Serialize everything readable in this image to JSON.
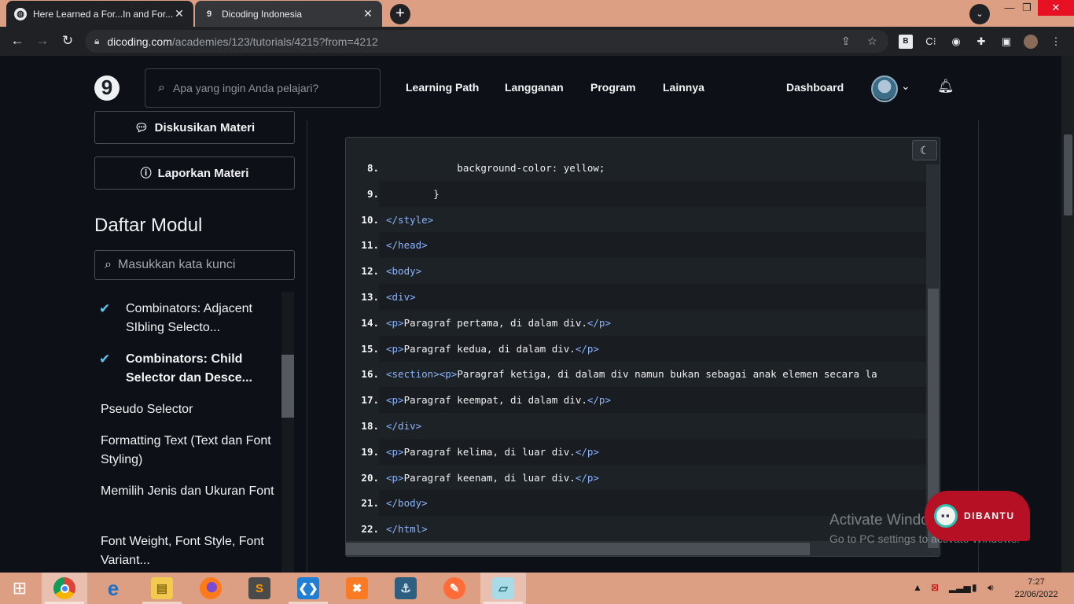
{
  "browser": {
    "tabs": [
      {
        "title": "Here Learned a For...In and For...c",
        "active": true,
        "favicon": "globe-icon"
      },
      {
        "title": "Dicoding Indonesia",
        "active": false,
        "favicon": "dicoding-icon"
      }
    ],
    "new_tab": "+",
    "url_host": "dicoding.com",
    "url_path": "/academies/123/tutorials/4215?from=4212"
  },
  "header": {
    "search_placeholder": "Apa yang ingin Anda pelajari?",
    "nav": [
      "Learning Path",
      "Langganan",
      "Program",
      "Lainnya"
    ],
    "dashboard": "Dashboard"
  },
  "sidebar": {
    "discuss_button": "Diskusikan Materi",
    "report_button": "Laporkan Materi",
    "module_title": "Daftar Modul",
    "module_search_placeholder": "Masukkan kata kunci",
    "modules": [
      {
        "label": "Combinators: Adjacent SIbling Selecto...",
        "done": true,
        "active": false
      },
      {
        "label": "Combinators: Child Selector dan Desce...",
        "done": true,
        "active": true
      },
      {
        "label": "Pseudo Selector",
        "done": false,
        "active": false
      },
      {
        "label": "Formatting Text (Text dan Font Styling)",
        "done": false,
        "active": false
      },
      {
        "label": "Memilih Jenis dan Ukuran Font",
        "done": false,
        "active": false
      },
      {
        "label": "Font Weight, Font Style, Font Variant...",
        "done": false,
        "active": false
      }
    ]
  },
  "code": {
    "lines": [
      {
        "n": "8.",
        "text": "            background-color: yellow;"
      },
      {
        "n": "9.",
        "text": "        }"
      },
      {
        "n": "10.",
        "text": "    </style>"
      },
      {
        "n": "11.",
        "text": "</head>"
      },
      {
        "n": "12.",
        "text": "<body>"
      },
      {
        "n": "13.",
        "text": "<div>"
      },
      {
        "n": "14.",
        "text": "    <p>Paragraf pertama, di dalam div.</p>"
      },
      {
        "n": "15.",
        "text": "    <p>Paragraf kedua, di dalam div.</p>"
      },
      {
        "n": "16.",
        "text": "    <section><p>Paragraf ketiga, di dalam div namun bukan sebagai anak elemen secara la"
      },
      {
        "n": "17.",
        "text": "    <p>Paragraf keempat, di dalam div.</p>"
      },
      {
        "n": "18.",
        "text": "</div>"
      },
      {
        "n": "19.",
        "text": "<p>Paragraf kelima, di luar div.</p>"
      },
      {
        "n": "20.",
        "text": "<p>Paragraf keenam, di luar div.</p>"
      },
      {
        "n": "21.",
        "text": "</body>"
      },
      {
        "n": "22.",
        "text": "</html>"
      }
    ]
  },
  "overlay": {
    "activate_title": "Activate Windows",
    "activate_sub": "Go to PC settings to activate Windows.",
    "help_button": "DIBANTU"
  },
  "taskbar": {
    "apps": [
      "chrome-icon",
      "edge-icon",
      "file-explorer-icon",
      "firefox-icon",
      "sublime-text-icon",
      "vscode-icon",
      "xampp-icon",
      "mysql-workbench-icon",
      "postman-icon",
      "notepad-icon"
    ],
    "time": "7:27",
    "date": "22/06/2022"
  },
  "colors": {
    "accent": "#dd9f84",
    "tag": "#8ab4ff",
    "check": "#5ec5f0",
    "help": "#b51024"
  }
}
